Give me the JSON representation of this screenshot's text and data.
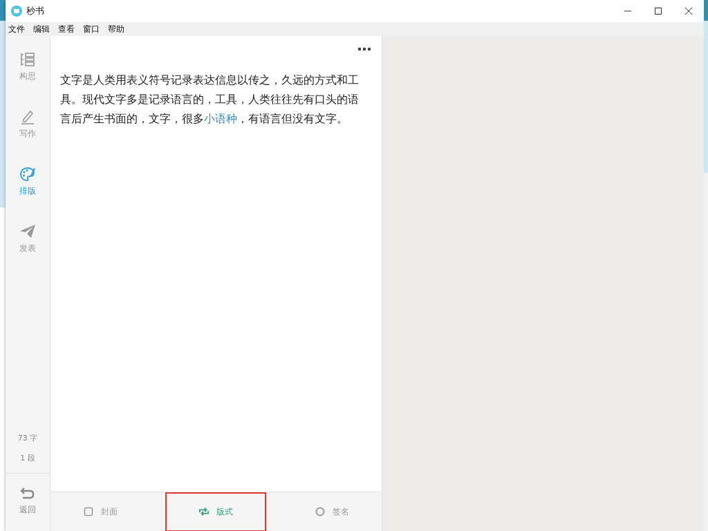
{
  "window": {
    "title": "秒书"
  },
  "menu": [
    "文件",
    "编辑",
    "查看",
    "窗口",
    "帮助"
  ],
  "sidebar": {
    "items": [
      {
        "label": "构思",
        "kind": "outline",
        "selected": false
      },
      {
        "label": "写作",
        "kind": "pen",
        "selected": false
      },
      {
        "label": "排版",
        "kind": "palette",
        "selected": true
      },
      {
        "label": "发表",
        "kind": "plane",
        "selected": false
      }
    ],
    "stats": [
      "73 字",
      "1 段"
    ],
    "back": "返回"
  },
  "editor": {
    "paragraph": [
      {
        "kind": "text",
        "text": "文字是人类用表义符号记录表达信息以传之，久远的方式和工具。现代文字多是记录语言的，工具，人类往往先有口头的语言后产生书面的，文字，很多"
      },
      {
        "kind": "link",
        "text": "小语种"
      },
      {
        "kind": "text",
        "text": "，有语言但没有文字。"
      }
    ]
  },
  "bottom_tabs": [
    {
      "label": "封面",
      "kind": "square",
      "selected": false
    },
    {
      "label": "版式",
      "kind": "repeat",
      "selected": true
    },
    {
      "label": "签名",
      "kind": "circle",
      "selected": false
    }
  ]
}
